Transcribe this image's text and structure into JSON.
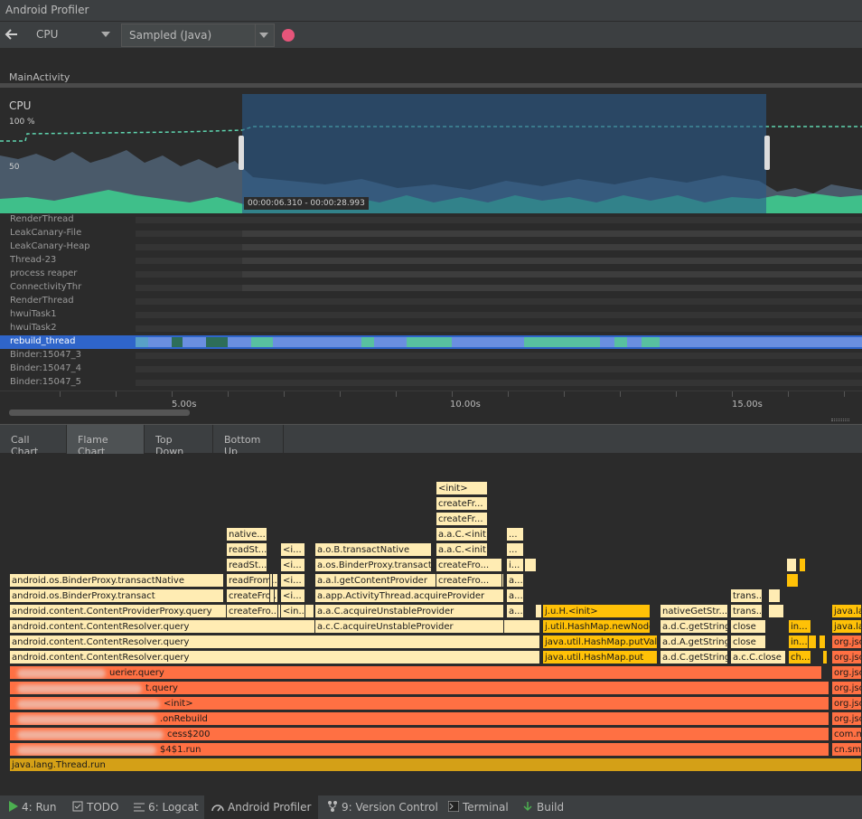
{
  "window": {
    "title": "Android Profiler"
  },
  "toolbar": {
    "profiler_select": "CPU",
    "config_select": "Sampled (Java)"
  },
  "activity": {
    "label": "MainActivity"
  },
  "cpu": {
    "title": "CPU",
    "y_top": "100 %",
    "y_mid": "50",
    "selection_range": "00:00:06.310 - 00:00:28.993"
  },
  "threads": [
    "RenderThread",
    "LeakCanary-File",
    "LeakCanary-Heap",
    "Thread-23",
    "process reaper",
    "ConnectivityThr",
    "RenderThread",
    "hwuiTask1",
    "hwuiTask2",
    "rebuild_thread",
    "Binder:15047_3",
    "Binder:15047_4",
    "Binder:15047_5"
  ],
  "time_axis": [
    "5.00s",
    "10.00s",
    "15.00s"
  ],
  "tabs": [
    "Call Chart",
    "Flame Chart",
    "Top Down",
    "Bottom Up"
  ],
  "flame": {
    "rows": [
      {
        "label": "java.lang.Thread.run"
      },
      {
        "label": "$4$1.run"
      },
      {
        "label": "cess$200"
      },
      {
        "label": ".onRebuild"
      },
      {
        "label": "<init>"
      },
      {
        "label": "t.query"
      },
      {
        "label": "uerier.query"
      }
    ],
    "left_col": [
      "android.content.ContentResolver.query",
      "android.content.ContentResolver.query",
      "android.content.ContentResolver.query",
      "android.content.ContentProviderProxy.query",
      "android.os.BinderProxy.transact",
      "android.os.BinderProxy.transactNative"
    ],
    "mid_col": [
      "createFro...",
      "createFro...",
      "readFrom...",
      "readSt...",
      "readSt...",
      "native..."
    ],
    "small_col": [
      "<in...",
      "<i...",
      "<i...",
      "<i...",
      "<i..."
    ],
    "binder_col": [
      "a.c.C.acquireUnstableProvider",
      "a.a.C.acquireUnstableProvider",
      "a.app.ActivityThread.acquireProvider",
      "a.a.l.getContentProvider",
      "a.os.BinderProxy.transact",
      "a.o.B.transactNative"
    ],
    "create_col": [
      "createFro...",
      "createFro...",
      "a.a.C.<init>",
      "a.a.C.<init>",
      "createFr...",
      "createFr...",
      "<init>"
    ],
    "a_col": [
      "a...",
      "a...",
      "a...",
      "i...",
      "...",
      "..."
    ],
    "hashmap_col": [
      "java.util.HashMap.put",
      "java.util.HashMap.putVal",
      "j.util.HashMap.newNode",
      "j.u.H.<init>"
    ],
    "getstring_col": [
      "a.d.C.getString",
      "a.d.A.getString",
      "a.d.C.getString",
      "nativeGetStr..."
    ],
    "close_col": [
      "a.c.C.close",
      "close",
      "close",
      "trans...",
      "trans..."
    ],
    "t_col": [
      "ch...",
      "in...",
      "in..."
    ],
    "right_col": [
      "cn.sma",
      "com.m",
      "org.jso",
      "org.jso",
      "org.jso",
      "org.jso",
      "org.jso",
      "org.jso",
      "java.la",
      "java.la"
    ]
  },
  "statusbar": {
    "run": "4: Run",
    "todo": "TODO",
    "logcat": "6: Logcat",
    "profiler": "Android Profiler",
    "vcs": "9: Version Control",
    "terminal": "Terminal",
    "build": "Build"
  },
  "colors": {
    "accent_record": "#e6557a",
    "selection": "#2a5a8a",
    "thread_selected": "#2f65ca",
    "cpu_app": "#3fbf8a",
    "cpu_other": "#4a5a6a"
  }
}
